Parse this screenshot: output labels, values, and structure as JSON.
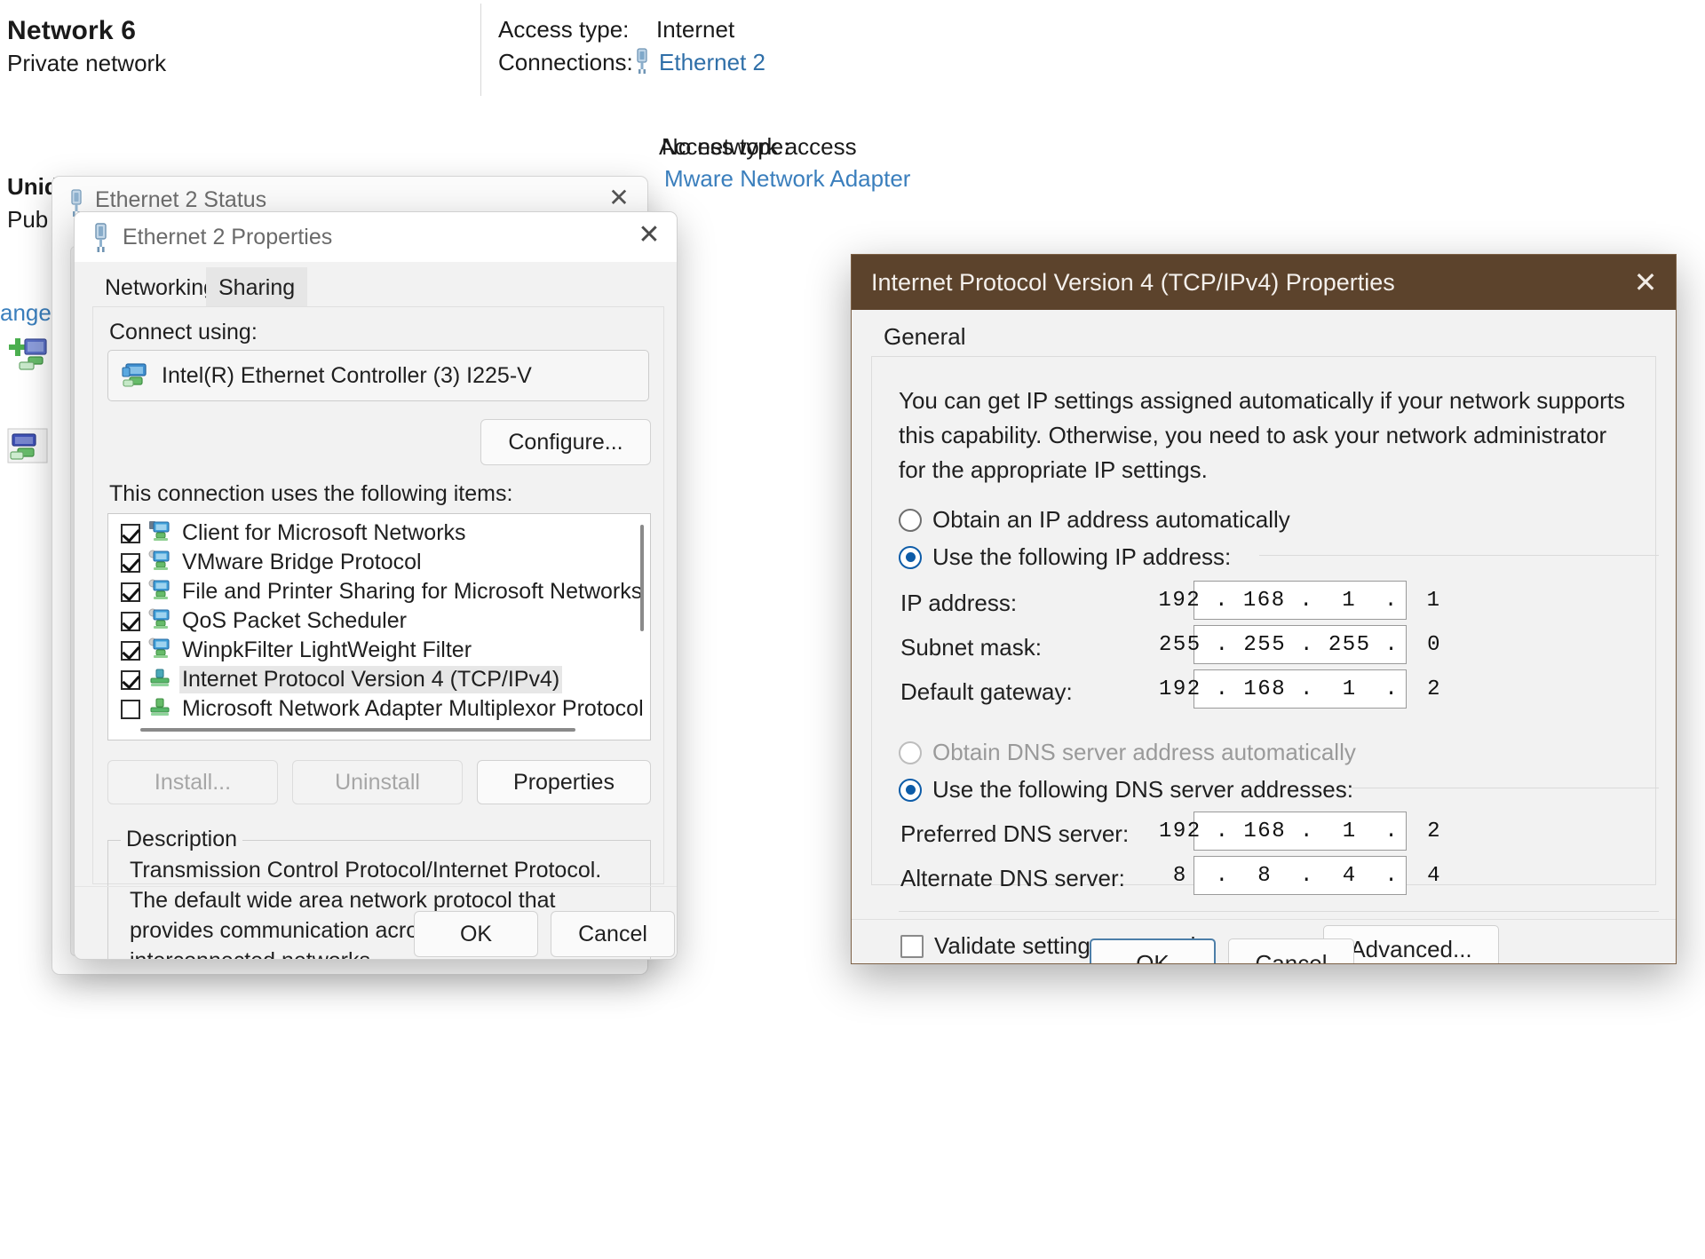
{
  "background": {
    "network_name": "Network  6",
    "network_type": "Private network",
    "access_type_label": "Access type:",
    "access_type_value": "Internet",
    "connections_label": "Connections:",
    "connections_value": "Ethernet 2",
    "connection_icon": "ethernet-plug-icon",
    "second_network_name_partial": "Unid",
    "second_network_type_partial": "Pub",
    "change_link_partial": "ange",
    "no_network_access": "No network access",
    "vmware_adapter_partial": "Mware Network Adapter",
    "access_type_partial": "Access type:",
    "adapter_add_icon": "add-network-adapter-icon",
    "adapter_icon": "network-adapter-icon"
  },
  "status_window": {
    "title": "Ethernet 2 Status",
    "close_icon": "close-icon",
    "window_icon": "ethernet-plug-icon"
  },
  "props_dialog": {
    "title": "Ethernet 2 Properties",
    "close_icon": "close-icon",
    "window_icon": "ethernet-plug-icon",
    "tabs": [
      {
        "label": "Networking",
        "selected": true
      },
      {
        "label": "Sharing",
        "selected": false
      }
    ],
    "connect_using_label": "Connect using:",
    "adapter": {
      "name": "Intel(R) Ethernet Controller (3) I225-V",
      "icon": "network-adapter-icon"
    },
    "configure_button": "Configure...",
    "items_label": "This connection uses the following items:",
    "items": [
      {
        "label": "Client for Microsoft Networks",
        "checked": true,
        "selected": false,
        "icon": "network-client-icon"
      },
      {
        "label": "VMware Bridge Protocol",
        "checked": true,
        "selected": false,
        "icon": "network-service-icon"
      },
      {
        "label": "File and Printer Sharing for Microsoft Networks",
        "checked": true,
        "selected": false,
        "icon": "network-service-icon"
      },
      {
        "label": "QoS Packet Scheduler",
        "checked": true,
        "selected": false,
        "icon": "network-service-icon"
      },
      {
        "label": "WinpkFilter LightWeight Filter",
        "checked": true,
        "selected": false,
        "icon": "network-service-icon"
      },
      {
        "label": "Internet Protocol Version 4 (TCP/IPv4)",
        "checked": true,
        "selected": true,
        "icon": "network-protocol-icon"
      },
      {
        "label": "Microsoft Network Adapter Multiplexor Protocol",
        "checked": false,
        "selected": false,
        "icon": "network-protocol-icon"
      }
    ],
    "install_button": "Install...",
    "uninstall_button": "Uninstall",
    "properties_button": "Properties",
    "description_title": "Description",
    "description_text": "Transmission Control Protocol/Internet Protocol. The default wide area network protocol that provides communication across diverse interconnected networks.",
    "ok_button": "OK",
    "cancel_button": "Cancel"
  },
  "ipv4_dialog": {
    "title": "Internet Protocol Version 4 (TCP/IPv4) Properties",
    "close_icon": "close-icon",
    "titlebar_color": "#5c432c",
    "tabs": [
      {
        "label": "General",
        "selected": true
      }
    ],
    "intro_text": "You can get IP settings assigned automatically if your network supports this capability. Otherwise, you need to ask your network administrator for the appropriate IP settings.",
    "ip_mode": {
      "auto_label": "Obtain an IP address automatically",
      "auto_selected": false,
      "manual_label": "Use the following IP address:",
      "manual_selected": true
    },
    "ip_fields": [
      {
        "label": "IP address:",
        "value": "192 . 168 .  1  .  1",
        "has_caret": true
      },
      {
        "label": "Subnet mask:",
        "value": "255 . 255 . 255 .  0",
        "has_caret": false
      },
      {
        "label": "Default gateway:",
        "value": "192 . 168 .  1  .  2",
        "has_caret": false
      }
    ],
    "dns_mode": {
      "auto_label": "Obtain DNS server address automatically",
      "auto_selected": false,
      "auto_disabled": true,
      "manual_label": "Use the following DNS server addresses:",
      "manual_selected": true
    },
    "dns_fields": [
      {
        "label": "Preferred DNS server:",
        "value": "192 . 168 .  1  .  2",
        "has_caret": false
      },
      {
        "label": "Alternate DNS server:",
        "value": " 8  .  8  .  4  .  4",
        "has_caret": false
      }
    ],
    "validate_checkbox": {
      "label": "Validate settings upon exit",
      "checked": false
    },
    "advanced_button": "Advanced...",
    "ok_button": "OK",
    "cancel_button": "Cancel",
    "ok_focused": true
  }
}
